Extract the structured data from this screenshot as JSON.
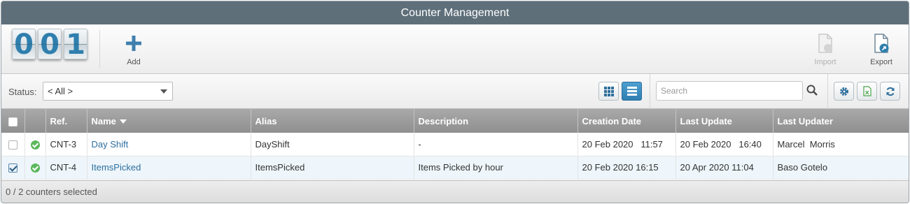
{
  "window": {
    "title": "Counter Management"
  },
  "logo": {
    "digits": [
      "0",
      "0",
      "1"
    ]
  },
  "toolbar": {
    "add_label": "Add",
    "import_label": "Import",
    "export_label": "Export"
  },
  "filter": {
    "status_label": "Status:",
    "status_value": "< All >",
    "search_placeholder": "Search"
  },
  "table": {
    "columns": [
      "",
      "",
      "Ref.",
      "Name",
      "Alias",
      "Description",
      "Creation Date",
      "Last Update",
      "Last Updater"
    ],
    "rows": [
      {
        "checked": false,
        "status": "ok",
        "ref": "CNT-3",
        "name": "Day Shift",
        "alias": "DayShift",
        "description": "-",
        "creation_date": "20 Feb 2020   11:57",
        "last_update": "20 Feb 2020   16:40",
        "last_updater": "Marcel  Morris"
      },
      {
        "checked": true,
        "status": "ok",
        "ref": "CNT-4",
        "name": "ItemsPicked",
        "alias": "ItemsPicked",
        "description": "Items Picked by hour",
        "creation_date": "20 Feb 2020 16:15",
        "last_update": "20 Apr 2020 11:04",
        "last_updater": "Baso Gotelo"
      }
    ]
  },
  "footer": {
    "selection_text": "0 / 2 counters selected"
  },
  "colors": {
    "titlebar": "#5e6f7a",
    "accent": "#2f7fae",
    "ok_green": "#5cb85c",
    "header_gray": "#999999"
  }
}
